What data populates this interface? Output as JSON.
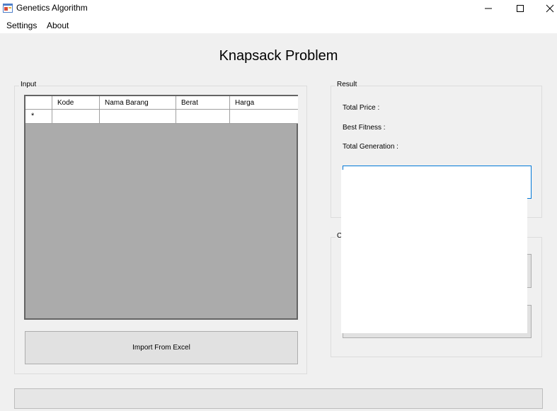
{
  "window": {
    "title": "Genetics Algorithm",
    "controls": {
      "minimize": "—",
      "maximize": "☐",
      "close": "✕"
    }
  },
  "menu": {
    "items": [
      "Settings",
      "About"
    ]
  },
  "main": {
    "heading": "Knapsack Problem"
  },
  "input_group": {
    "label": "Input",
    "grid": {
      "columns": [
        "Kode",
        "Nama Barang",
        "Berat",
        "Harga"
      ],
      "new_row_marker": "*"
    },
    "import_button": "Import From Excel"
  },
  "result_group": {
    "label": "Result",
    "total_price_label": "Total Price :",
    "best_fitness_label": "Best Fitness :",
    "total_generation_label": "Total Generation :"
  },
  "control_group": {
    "label": "C"
  },
  "progress": {
    "value": 0
  }
}
